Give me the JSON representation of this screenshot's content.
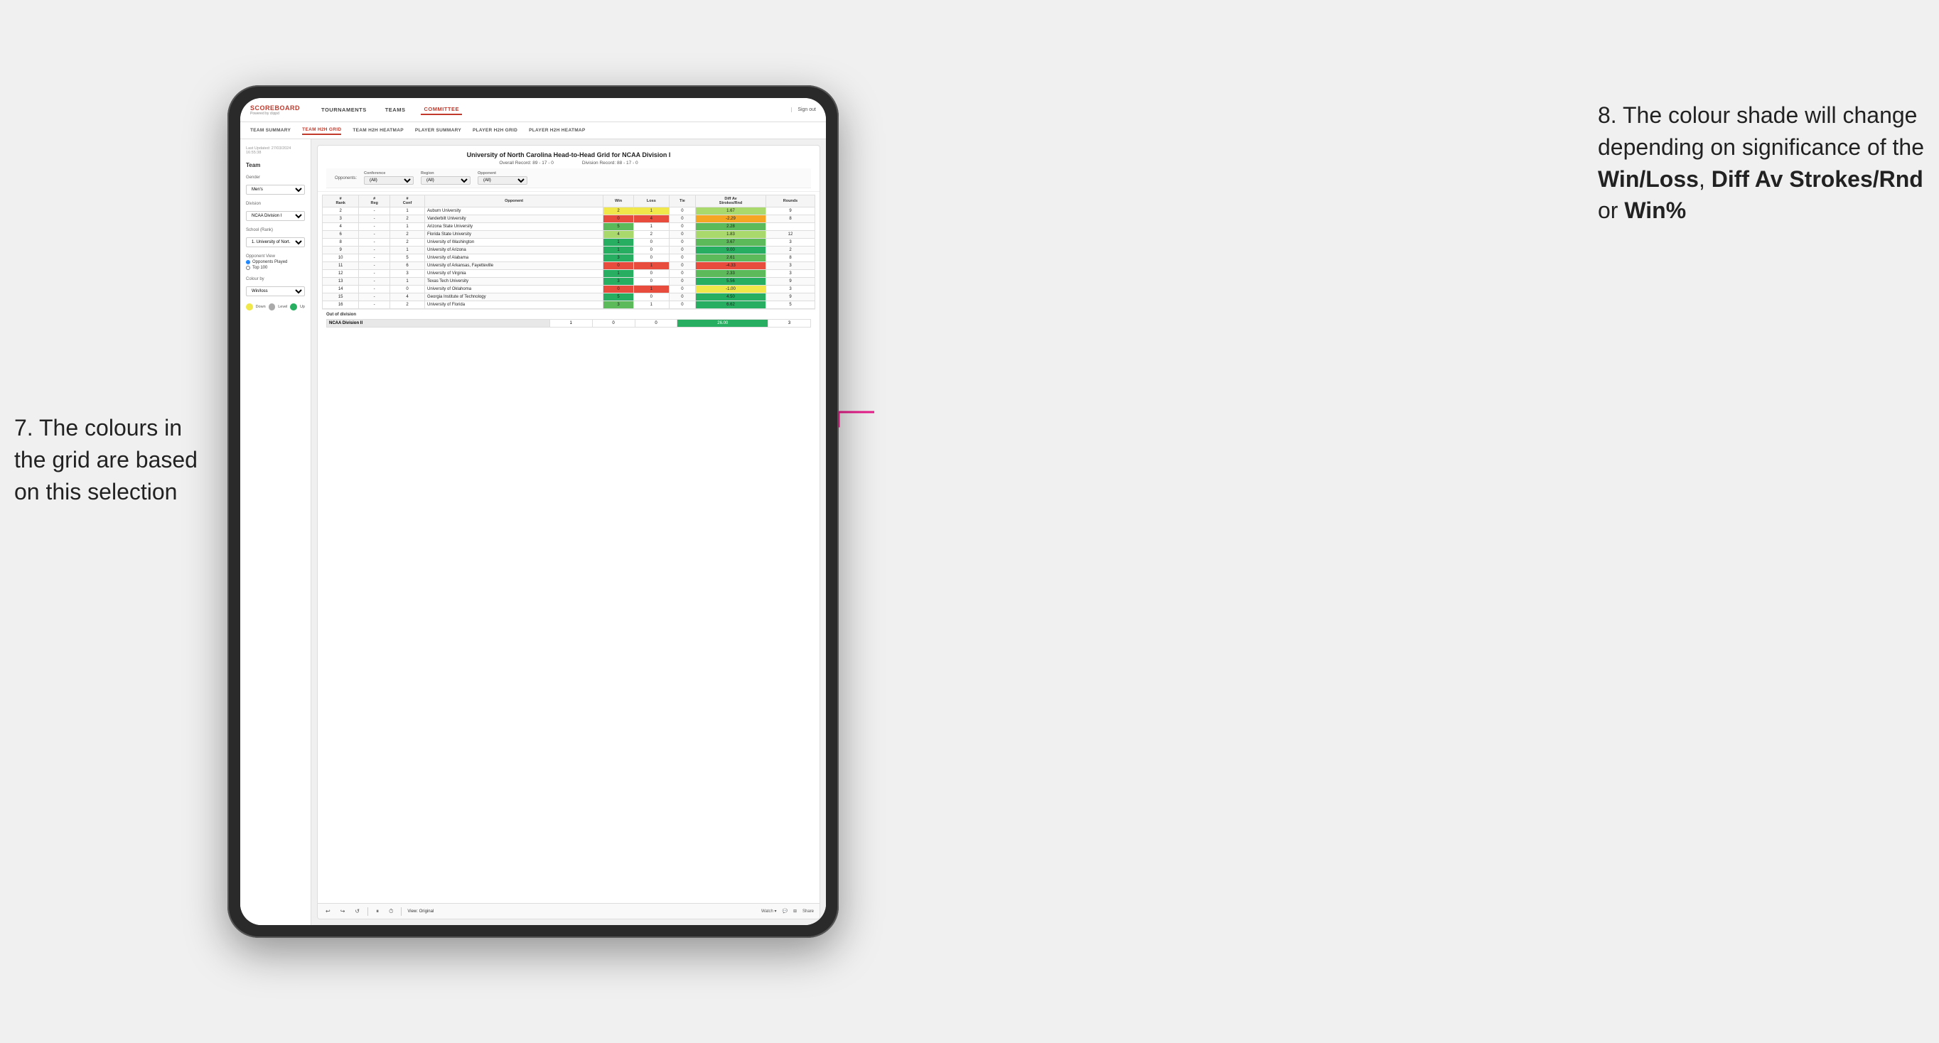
{
  "annotations": {
    "left": {
      "text": "7. The colours in the grid are based on this selection"
    },
    "right": {
      "text1": "8. The colour shade will change depending on significance of the ",
      "bold1": "Win/Loss",
      "text2": ", ",
      "bold2": "Diff Av Strokes/Rnd",
      "text3": " or ",
      "bold3": "Win%"
    }
  },
  "nav": {
    "logo_title": "SCOREBOARD",
    "logo_sub": "Powered by clippd",
    "items": [
      "TOURNAMENTS",
      "TEAMS",
      "COMMITTEE"
    ],
    "active_item": "COMMITTEE",
    "sign_out": "Sign out"
  },
  "sub_nav": {
    "items": [
      "TEAM SUMMARY",
      "TEAM H2H GRID",
      "TEAM H2H HEATMAP",
      "PLAYER SUMMARY",
      "PLAYER H2H GRID",
      "PLAYER H2H HEATMAP"
    ],
    "active": "TEAM H2H GRID"
  },
  "sidebar": {
    "last_updated_label": "Last Updated: 27/03/2024",
    "time": "16:55:38",
    "team_label": "Team",
    "gender_label": "Gender",
    "gender_value": "Men's",
    "division_label": "Division",
    "division_value": "NCAA Division I",
    "school_label": "School (Rank)",
    "school_value": "1. University of Nort...",
    "opponent_view_label": "Opponent View",
    "opponents_played": "Opponents Played",
    "top100": "Top 100",
    "colour_by_label": "Colour by",
    "colour_by_value": "Win/loss",
    "legend": {
      "down": "Down",
      "level": "Level",
      "up": "Up"
    }
  },
  "filters": {
    "opponents_label": "Opponents:",
    "opponents_value": "(All)",
    "conference_label": "Conference",
    "conference_value": "(All)",
    "region_label": "Region",
    "region_value": "(All)",
    "opponent_label": "Opponent",
    "opponent_value": "(All)"
  },
  "report": {
    "title": "University of North Carolina Head-to-Head Grid for NCAA Division I",
    "overall_record": "Overall Record: 89 - 17 - 0",
    "division_record": "Division Record: 88 - 17 - 0"
  },
  "table": {
    "headers": [
      "#\nRank",
      "#\nReg",
      "#\nConf",
      "Opponent",
      "Win",
      "Loss",
      "Tie",
      "Diff Av\nStrokes/Rnd",
      "Rounds"
    ],
    "rows": [
      {
        "rank": "2",
        "reg": "-",
        "conf": "1",
        "opponent": "Auburn University",
        "win": "2",
        "loss": "1",
        "tie": "0",
        "diff": "1.67",
        "rounds": "9",
        "win_color": "yellow",
        "diff_color": "green_light"
      },
      {
        "rank": "3",
        "reg": "-",
        "conf": "2",
        "opponent": "Vanderbilt University",
        "win": "0",
        "loss": "4",
        "tie": "0",
        "diff": "-2.29",
        "rounds": "8",
        "win_color": "red_mid",
        "diff_color": "red_light"
      },
      {
        "rank": "4",
        "reg": "-",
        "conf": "1",
        "opponent": "Arizona State University",
        "win": "5",
        "loss": "1",
        "tie": "0",
        "diff": "2.28",
        "rounds": "",
        "win_color": "green_mid",
        "diff_color": "green_mid"
      },
      {
        "rank": "6",
        "reg": "-",
        "conf": "2",
        "opponent": "Florida State University",
        "win": "4",
        "loss": "2",
        "tie": "0",
        "diff": "1.83",
        "rounds": "12",
        "win_color": "green_light",
        "diff_color": "green_light"
      },
      {
        "rank": "8",
        "reg": "-",
        "conf": "2",
        "opponent": "University of Washington",
        "win": "1",
        "loss": "0",
        "tie": "0",
        "diff": "3.67",
        "rounds": "3",
        "win_color": "green_dark",
        "diff_color": "green_mid"
      },
      {
        "rank": "9",
        "reg": "-",
        "conf": "1",
        "opponent": "University of Arizona",
        "win": "1",
        "loss": "0",
        "tie": "0",
        "diff": "9.00",
        "rounds": "2",
        "win_color": "green_dark",
        "diff_color": "green_dark"
      },
      {
        "rank": "10",
        "reg": "-",
        "conf": "5",
        "opponent": "University of Alabama",
        "win": "3",
        "loss": "0",
        "tie": "0",
        "diff": "2.61",
        "rounds": "8",
        "win_color": "green_dark",
        "diff_color": "green_mid"
      },
      {
        "rank": "11",
        "reg": "-",
        "conf": "6",
        "opponent": "University of Arkansas, Fayetteville",
        "win": "0",
        "loss": "1",
        "tie": "0",
        "diff": "-4.33",
        "rounds": "3",
        "win_color": "red_mid",
        "diff_color": "red_mid"
      },
      {
        "rank": "12",
        "reg": "-",
        "conf": "3",
        "opponent": "University of Virginia",
        "win": "1",
        "loss": "0",
        "tie": "0",
        "diff": "2.33",
        "rounds": "3",
        "win_color": "green_dark",
        "diff_color": "green_mid"
      },
      {
        "rank": "13",
        "reg": "-",
        "conf": "1",
        "opponent": "Texas Tech University",
        "win": "3",
        "loss": "0",
        "tie": "0",
        "diff": "5.56",
        "rounds": "9",
        "win_color": "green_dark",
        "diff_color": "green_dark"
      },
      {
        "rank": "14",
        "reg": "-",
        "conf": "0",
        "opponent": "University of Oklahoma",
        "win": "0",
        "loss": "1",
        "tie": "0",
        "diff": "-1.00",
        "rounds": "3",
        "win_color": "red_mid",
        "diff_color": "yellow"
      },
      {
        "rank": "15",
        "reg": "-",
        "conf": "4",
        "opponent": "Georgia Institute of Technology",
        "win": "5",
        "loss": "0",
        "tie": "0",
        "diff": "4.50",
        "rounds": "9",
        "win_color": "green_dark",
        "diff_color": "green_dark"
      },
      {
        "rank": "16",
        "reg": "-",
        "conf": "2",
        "opponent": "University of Florida",
        "win": "3",
        "loss": "1",
        "tie": "0",
        "diff": "6.62",
        "rounds": "5",
        "win_color": "green_mid",
        "diff_color": "green_dark"
      }
    ],
    "out_of_division": {
      "label": "Out of division",
      "rows": [
        {
          "name": "NCAA Division II",
          "win": "1",
          "loss": "0",
          "tie": "0",
          "diff": "26.00",
          "rounds": "3",
          "diff_color": "green_dark"
        }
      ]
    }
  },
  "toolbar": {
    "view_label": "View: Original",
    "watch_label": "Watch ▾",
    "share_label": "Share"
  }
}
